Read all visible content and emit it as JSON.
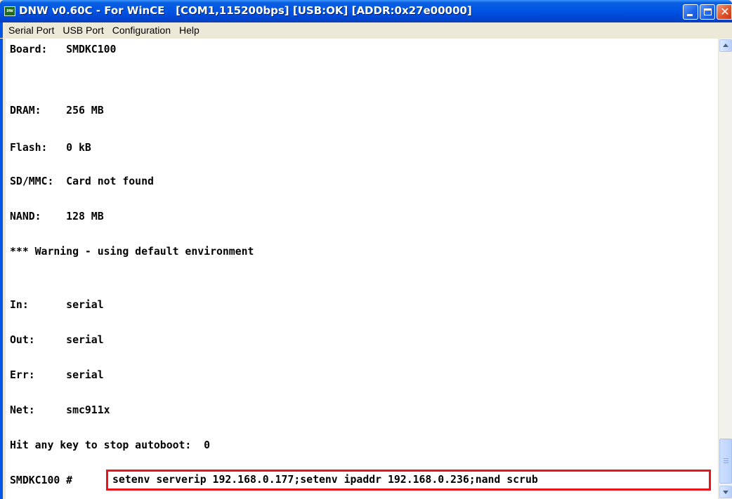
{
  "window": {
    "title": "DNW v0.60C - For WinCE   [COM1,115200bps] [USB:OK] [ADDR:0x27e00000]",
    "icon_label": "DNW",
    "colors": {
      "titlebar": "#0055e5",
      "console_bg": "#ffffff",
      "highlight_box": "#e8141a"
    }
  },
  "menu": {
    "items": [
      "Serial Port",
      "USB Port",
      "Configuration",
      "Help"
    ]
  },
  "console": {
    "lines": [
      "Board:   SMDKC100",
      "DRAM:    256 MB",
      "Flash:   0 kB",
      "SD/MMC:  Card not found",
      "NAND:    128 MB",
      "*** Warning - using default environment",
      "In:      serial",
      "Out:     serial",
      "Err:     serial",
      "Net:     smc911x",
      "Hit any key to stop autoboot:  0"
    ],
    "prompt": "SMDKC100 #",
    "command": "setenv serverip 192.168.0.177;setenv ipaddr 192.168.0.236;nand scrub"
  }
}
